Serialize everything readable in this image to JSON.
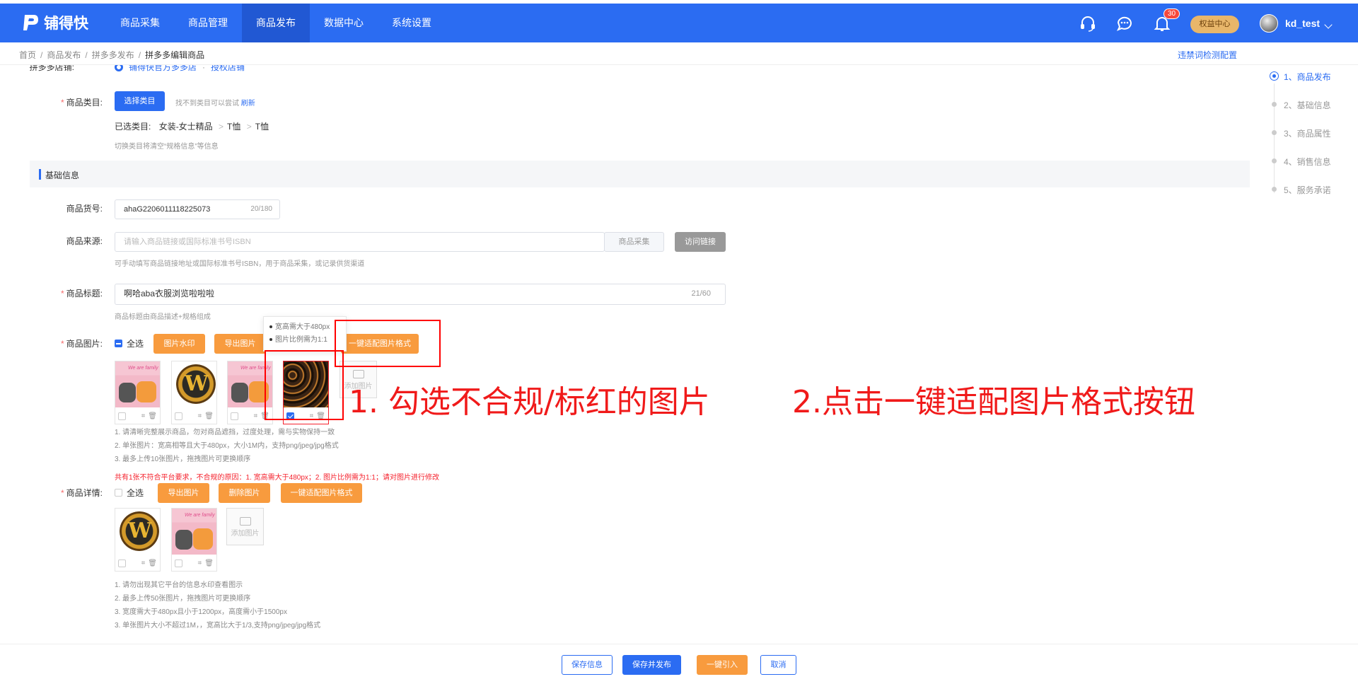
{
  "header": {
    "logo_text": "铺得快",
    "nav": [
      "商品采集",
      "商品管理",
      "商品发布",
      "数据中心",
      "系统设置"
    ],
    "active_nav": 2,
    "notification_count": "30",
    "vip_label": "权益中心",
    "username": "kd_test",
    "colors": {
      "primary": "#2b6cf2",
      "accent": "#f89b3e",
      "error": "#f5222d"
    }
  },
  "breadcrumb": {
    "items": [
      "首页",
      "商品发布",
      "拼多多发布",
      "拼多多编辑商品"
    ],
    "violation_link": "违禁词检测配置"
  },
  "form": {
    "pdd_store_label": "拼多多店铺:",
    "pdd_store_value": "铺得快官方多多店",
    "pdd_store_auth": "授权店铺",
    "category_label": "商品类目:",
    "category_button": "选择类目",
    "category_hint_prefix": "找不到类目可以尝试",
    "category_refresh": "刷新",
    "selected_category_label": "已选类目:",
    "selected_category_path": [
      "女装-女士精品",
      "T恤",
      "T恤"
    ],
    "category_switch_hint": "切换类目将清空“规格信息”等信息",
    "section_title": "基础信息",
    "sku_label": "商品货号:",
    "sku_value": "ahaG2206011118225073",
    "sku_count": "20/180",
    "source_label": "商品来源:",
    "source_placeholder": "请输入商品链接或国际标准书号ISBN",
    "source_collect_button": "商品采集",
    "source_visit_button": "访问链接",
    "source_hint": "可手动填写商品链接地址或国际标准书号ISBN，用于商品采集，或记录供货渠道",
    "title_label": "商品标题:",
    "title_value": "啊哈aba衣服浏览啦啦啦",
    "title_count": "21/60",
    "title_hint": "商品标题由商品描述+规格组成",
    "images_label": "商品图片:",
    "select_all": "全选",
    "watermark_button": "图片水印",
    "export_button": "导出图片",
    "adapt_button": "一键适配图片格式",
    "add_image": "添加图片",
    "tooltip_lines": [
      "宽高需大于480px",
      "图片比例需为1:1"
    ],
    "image_notes": [
      "1. 请清晰完整展示商品，勿对商品遮挡，过度处理，需与实物保持一致",
      "2. 单张图片：宽高相等且大于480px，大小1M内，支持png/jpeg/jpg格式",
      "3. 最多上传10张图片，拖拽图片可更换顺序"
    ],
    "image_error": "共有1张不符合平台要求，不合规的原因：1. 宽高需大于480px；2. 图片比例需为1:1；请对图片进行修改",
    "detail_label": "商品详情:",
    "delete_button": "删除图片",
    "detail_notes": [
      "1. 请勿出现其它平台的信息水印查看图示",
      "2. 最多上传50张图片，拖拽图片可更换顺序",
      "3. 宽度需大于480px且小于1200px，高度需小于1500px",
      "3. 单张图片大小不超过1M，，宽高比大于1/3,支持png/jpeg/jpg格式"
    ]
  },
  "annotations": {
    "step1": "1. 勾选不合规/标红的图片",
    "step2": "2.点击一键适配图片格式按钮"
  },
  "steps": [
    "1、商品发布",
    "2、基础信息",
    "3、商品属性",
    "4、销售信息",
    "5、服务承诺"
  ],
  "footer": {
    "save": "保存信息",
    "save_publish": "保存并发布",
    "one_click": "一键引入",
    "cancel": "取消"
  }
}
